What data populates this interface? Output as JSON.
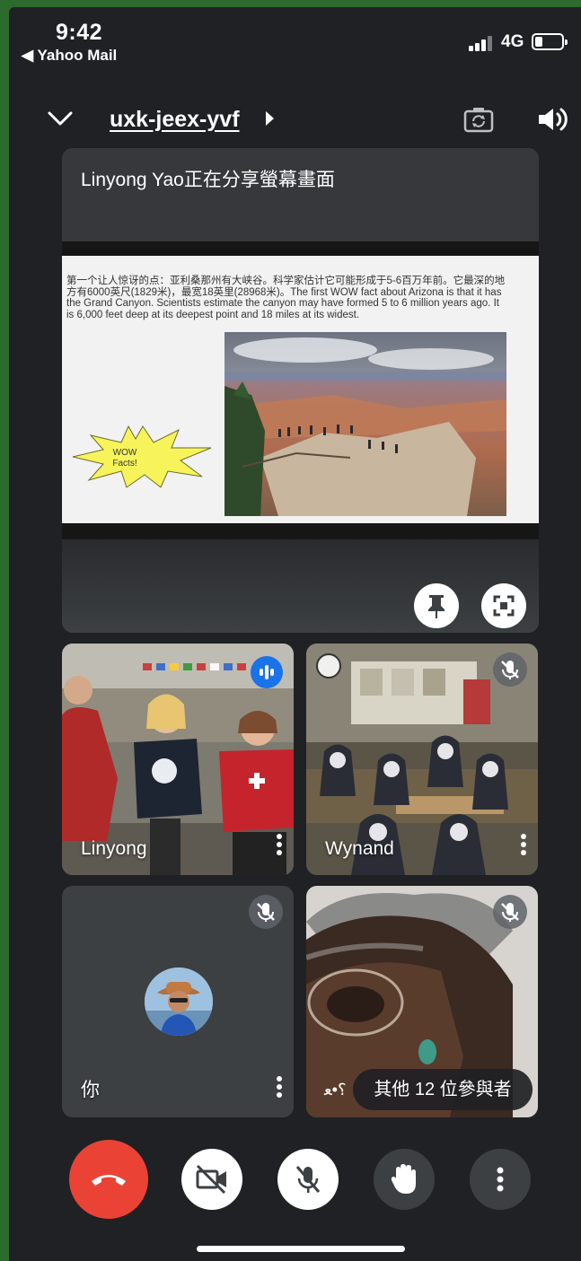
{
  "status_bar": {
    "time": "9:42",
    "back_app": "◀ Yahoo Mail",
    "network": "4G"
  },
  "header": {
    "meeting_code": "uxk-jeex-yvf"
  },
  "presentation": {
    "label": "Linyong Yao正在分享螢幕畫面",
    "slide_text": "第一个让人惊讶的点：亚利桑那州有大峡谷。科学家估计它可能形成于5-6百万年前。它最深的地方有6000英尺(1829米)，最宽18英里(28968米)。The first WOW fact about Arizona is that it has the Grand Canyon. Scientists estimate the canyon may have formed 5 to 6 million years ago. It is 6,000 feet deep at its deepest point and 18 miles at its widest.",
    "burst_line1": "WOW",
    "burst_line2": "Facts!"
  },
  "participants": [
    {
      "name": "Linyong",
      "state": "speaking"
    },
    {
      "name": "Wynand",
      "state": "muted"
    },
    {
      "name": "你",
      "state": "muted"
    },
    {
      "name": "؟•ﻌ",
      "state": "muted"
    }
  ],
  "others_pill": "其他 12 位參與者",
  "colors": {
    "end_call": "#ea4335",
    "speaking": "#1a73e8",
    "background": "#202124"
  },
  "icons": [
    "chevron-down-icon",
    "camera-flip-icon",
    "speaker-icon",
    "pin-icon",
    "fullscreen-icon",
    "mic-off-icon",
    "audio-level-icon",
    "more-vert-icon",
    "phone-hangup-icon",
    "camera-off-icon",
    "raise-hand-icon"
  ]
}
